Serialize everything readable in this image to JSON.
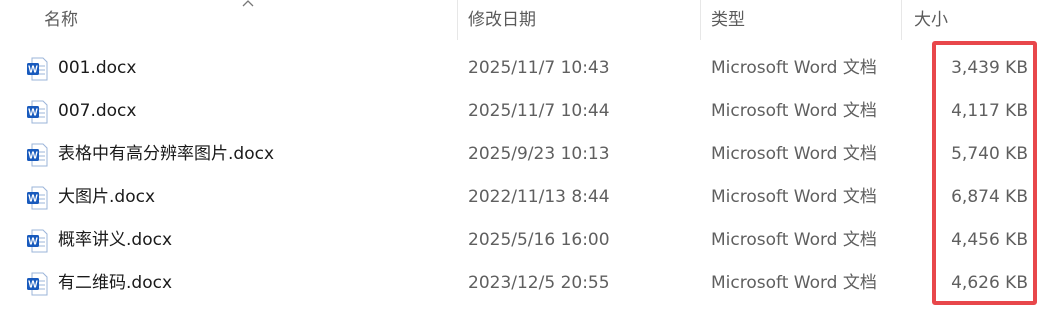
{
  "columns": {
    "name": "名称",
    "date": "修改日期",
    "type": "类型",
    "size": "大小"
  },
  "sort": {
    "column": "name",
    "direction": "ascending"
  },
  "files": [
    {
      "icon": "word-document-icon",
      "name": "001.docx",
      "modified": "2025/11/7 10:43",
      "type": "Microsoft Word 文档",
      "size": "3,439 KB"
    },
    {
      "icon": "word-document-icon",
      "name": "007.docx",
      "modified": "2025/11/7 10:44",
      "type": "Microsoft Word 文档",
      "size": "4,117 KB"
    },
    {
      "icon": "word-document-icon",
      "name": "表格中有高分辨率图片.docx",
      "modified": "2025/9/23 10:13",
      "type": "Microsoft Word 文档",
      "size": "5,740 KB"
    },
    {
      "icon": "word-document-icon",
      "name": "大图片.docx",
      "modified": "2022/11/13 8:44",
      "type": "Microsoft Word 文档",
      "size": "6,874 KB"
    },
    {
      "icon": "word-document-icon",
      "name": "概率讲义.docx",
      "modified": "2025/5/16 16:00",
      "type": "Microsoft Word 文档",
      "size": "4,456 KB"
    },
    {
      "icon": "word-document-icon",
      "name": "有二维码.docx",
      "modified": "2023/12/5 20:55",
      "type": "Microsoft Word 文档",
      "size": "4,626 KB"
    }
  ],
  "colors": {
    "highlight": "#e8474b",
    "word_icon": "#185abd"
  }
}
